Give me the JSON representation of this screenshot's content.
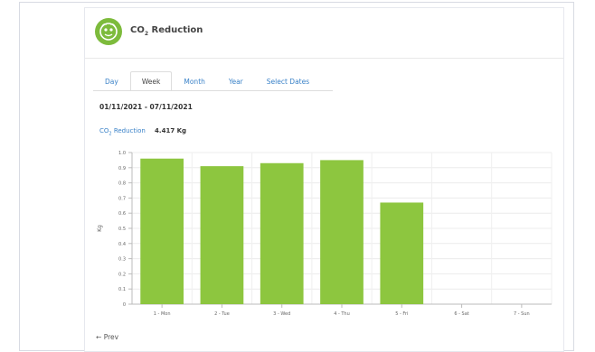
{
  "widget": {
    "title_prefix": "CO",
    "title_sub": "2",
    "title_suffix": " Reduction"
  },
  "tabs": [
    {
      "label": "Day",
      "active": false
    },
    {
      "label": "Week",
      "active": true
    },
    {
      "label": "Month",
      "active": false
    },
    {
      "label": "Year",
      "active": false
    },
    {
      "label": "Select Dates",
      "active": false
    }
  ],
  "date_range": "01/11/2021 - 07/11/2021",
  "summary": {
    "label_prefix": "CO",
    "label_sub": "2",
    "label_suffix": " Reduction",
    "value": "4.417 Kg"
  },
  "nav": {
    "prev_label": "Prev",
    "prev_arrow": "←"
  },
  "colors": {
    "bar": "#8dc63f",
    "accent": "#3a82c8",
    "logo": "#7dbb3c"
  },
  "chart_data": {
    "type": "bar",
    "ylabel": "Kg",
    "ylim": [
      0,
      1.0
    ],
    "yticks": [
      "0",
      "0.1",
      "0.2",
      "0.3",
      "0.4",
      "0.5",
      "0.6",
      "0.7",
      "0.8",
      "0.9",
      "1.0"
    ],
    "categories": [
      "1 - Mon",
      "2 - Tue",
      "3 - Wed",
      "4 - Thu",
      "5 - Fri",
      "6 - Sat",
      "7 - Sun"
    ],
    "values": [
      0.96,
      0.91,
      0.93,
      0.95,
      0.67,
      0,
      0
    ],
    "grid": true
  }
}
